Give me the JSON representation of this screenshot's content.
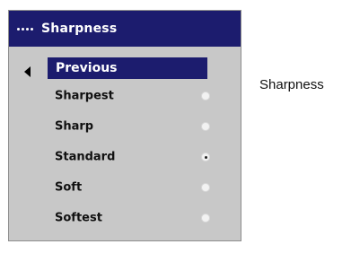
{
  "menu": {
    "title": "Sharpness",
    "previous_label": "Previous",
    "options": [
      {
        "label": "Sharpest",
        "selected": false
      },
      {
        "label": "Sharp",
        "selected": false
      },
      {
        "label": "Standard",
        "selected": true
      },
      {
        "label": "Soft",
        "selected": false
      },
      {
        "label": "Softest",
        "selected": false
      }
    ]
  },
  "side_label": "Sharpness",
  "colors": {
    "header_bg": "#1c1c6e",
    "menu_bg": "#c8c8c8",
    "text": "#111111"
  }
}
